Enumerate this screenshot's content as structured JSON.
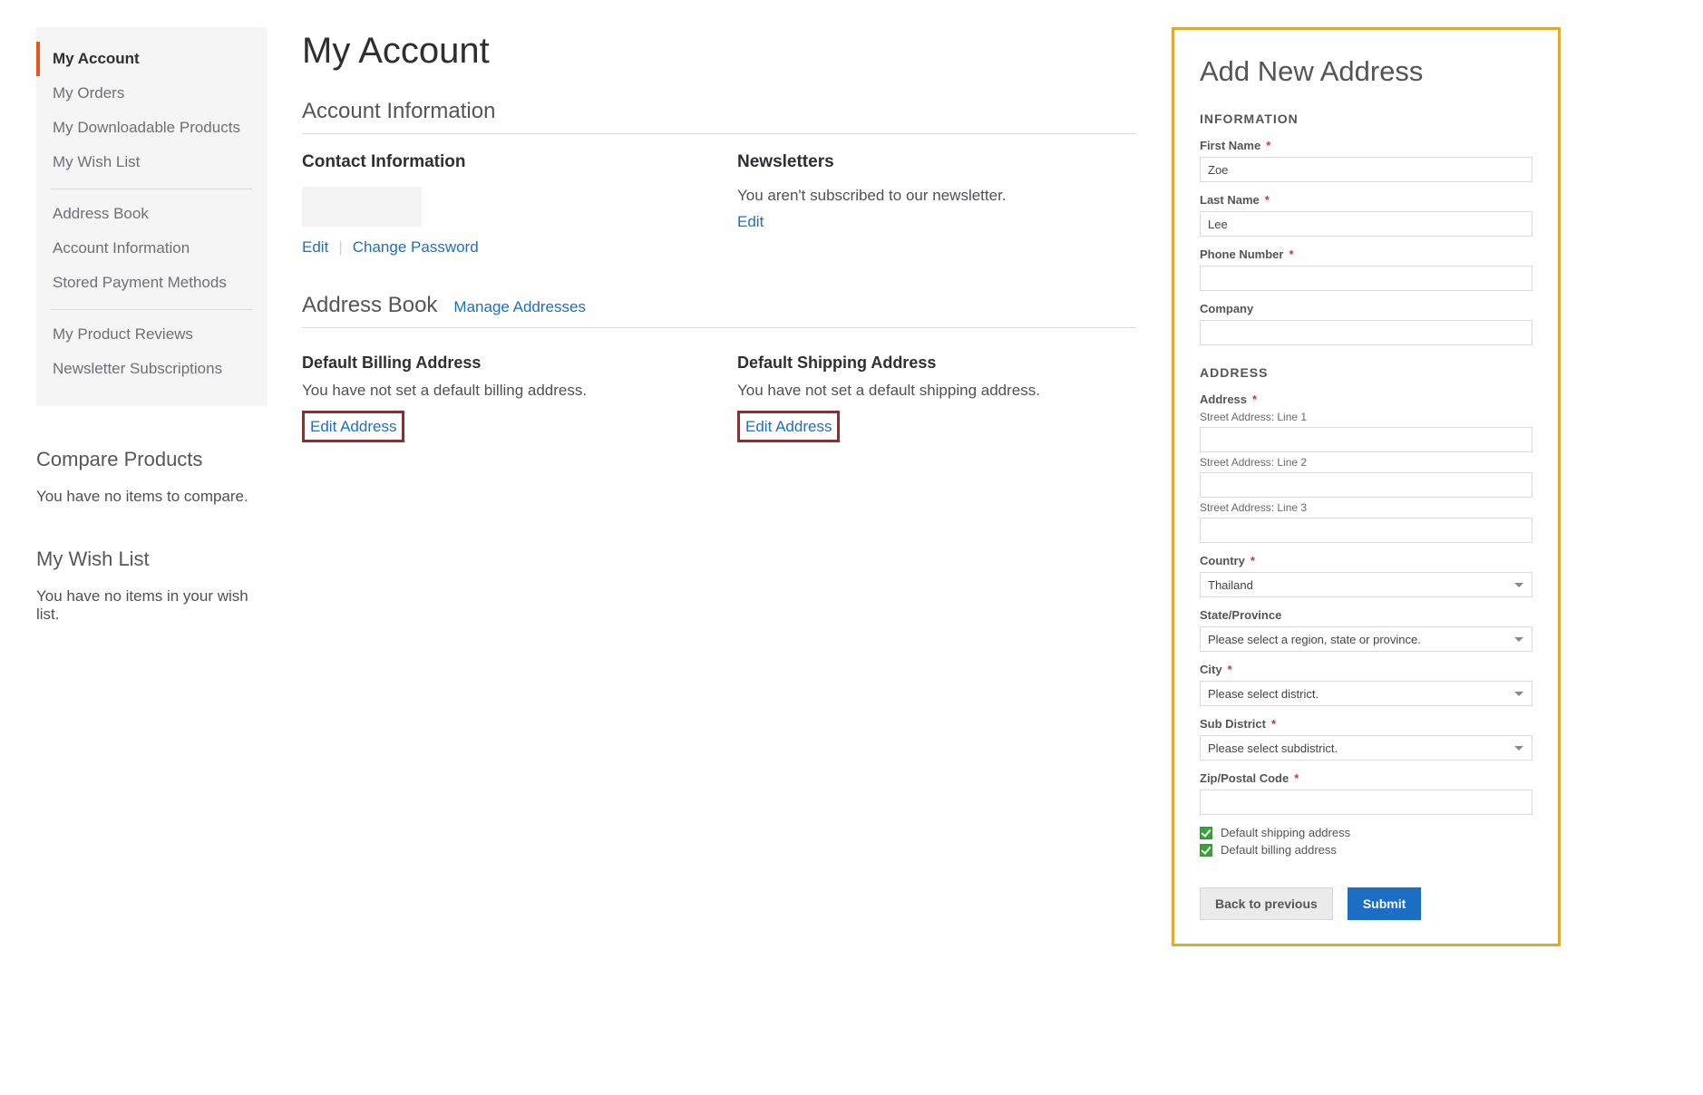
{
  "sidebar": {
    "groups": [
      {
        "items": [
          {
            "label": "My Account",
            "active": true
          },
          {
            "label": "My Orders"
          },
          {
            "label": "My Downloadable Products"
          },
          {
            "label": "My Wish List"
          }
        ]
      },
      {
        "items": [
          {
            "label": "Address Book"
          },
          {
            "label": "Account Information"
          },
          {
            "label": "Stored Payment Methods"
          }
        ]
      },
      {
        "items": [
          {
            "label": "My Product Reviews"
          },
          {
            "label": "Newsletter Subscriptions"
          }
        ]
      }
    ]
  },
  "aside": {
    "compare": {
      "title": "Compare Products",
      "message": "You have no items to compare."
    },
    "wishlist": {
      "title": "My Wish List",
      "message": "You have no items in your wish list."
    }
  },
  "main": {
    "page_title": "My Account",
    "account_info": {
      "section": "Account Information",
      "contact": {
        "heading": "Contact Information",
        "edit": "Edit",
        "change_pw": "Change Password"
      },
      "newsletters": {
        "heading": "Newsletters",
        "message": "You aren't subscribed to our newsletter.",
        "edit": "Edit"
      }
    },
    "address_book": {
      "section": "Address Book",
      "manage": "Manage Addresses",
      "billing": {
        "heading": "Default Billing Address",
        "message": "You have not set a default billing address.",
        "edit": "Edit Address"
      },
      "shipping": {
        "heading": "Default Shipping Address",
        "message": "You have not set a default shipping address.",
        "edit": "Edit Address"
      }
    }
  },
  "form": {
    "title": "Add New Address",
    "section_info": "INFORMATION",
    "section_addr": "ADDRESS",
    "first_name": {
      "label": "First Name",
      "value": "Zoe"
    },
    "last_name": {
      "label": "Last Name",
      "value": "Lee"
    },
    "phone": {
      "label": "Phone Number",
      "value": ""
    },
    "company": {
      "label": "Company",
      "value": ""
    },
    "address": {
      "label": "Address",
      "line1": "Street Address: Line 1",
      "line2": "Street Address: Line 2",
      "line3": "Street Address: Line 3"
    },
    "country": {
      "label": "Country",
      "value": "Thailand"
    },
    "state": {
      "label": "State/Province",
      "value": "Please select a region, state or province."
    },
    "city": {
      "label": "City",
      "value": "Please select district."
    },
    "subdistrict": {
      "label": "Sub District",
      "value": "Please select subdistrict."
    },
    "zip": {
      "label": "Zip/Postal Code",
      "value": ""
    },
    "default_shipping": "Default shipping address",
    "default_billing": "Default billing address",
    "back": "Back to previous",
    "submit": "Submit"
  }
}
